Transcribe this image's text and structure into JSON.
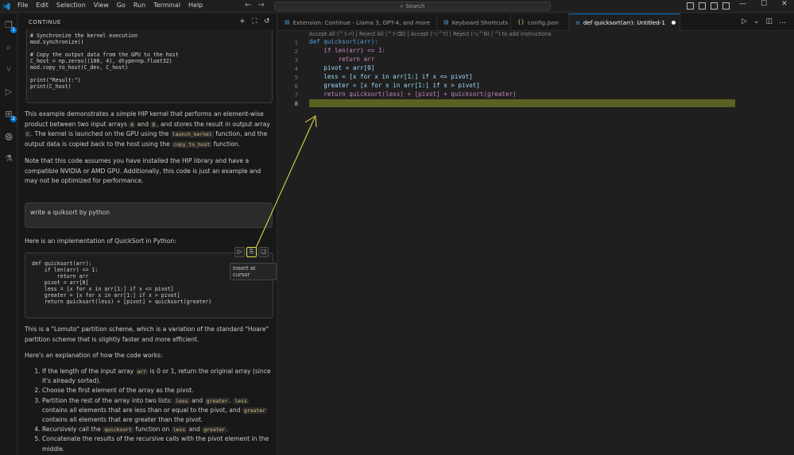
{
  "titlebar": {
    "menus": [
      "File",
      "Edit",
      "Selection",
      "View",
      "Go",
      "Run",
      "Terminal",
      "Help"
    ],
    "search_placeholder": "Search"
  },
  "activity": {
    "explorer_badge": "1",
    "extensions_badge": "2"
  },
  "sidebar": {
    "title": "CONTINUE",
    "prev_code": "# Synchronize the kernel execution\nmod.synchronize()\n\n# Copy the output data from the GPU to the host\nC_host = np.zeros((100, 4), dtype=np.float32)\nmod.copy_to_host(C_dev, C_host)\n\nprint(\"Result:\")\nprint(C_host)",
    "para1": {
      "t1": "This example demonstrates a simple HIP kernel that performs an element-wise product between two input arrays ",
      "c1": "A",
      "t2": " and ",
      "c2": "B",
      "t3": ", and stores the result in output array ",
      "c3": "C",
      "t4": ". The kernel is launched on the GPU using the ",
      "c4": "launch_kernel",
      "t5": " function, and the output data is copied back to the host using the ",
      "c5": "copy_to_host",
      "t6": " function."
    },
    "para2": "Note that this code assumes you have installed the HIP library and have a compatible NVIDIA or AMD GPU. Additionally, this code is just an example and may not be optimized for performance.",
    "user_prompt": "write a quiksort by python",
    "answer_intro": "Here is an implementation of QuickSort in Python:",
    "qs_code": "def quicksort(arr):\n    if len(arr) <= 1:\n        return arr\n    pivot = arr[0]\n    less = [x for x in arr[1:] if x <= pivot]\n    greater = [x for x in arr[1:] if x > pivot]\n    return quicksort(less) + [pivot] + quicksort(greater)",
    "tooltip": "Insert at cursor",
    "lomuto_text": "This is a \"Lomuto\" partition scheme, which is a variation of the standard \"Hoare\" partition scheme that is slightly faster and more efficient.",
    "explain_intro": "Here's an explanation of how the code works:",
    "steps": {
      "s1a": "If the length of the input array ",
      "s1c": "arr",
      "s1b": " is 0 or 1, return the original array (since it's already sorted).",
      "s2": "Choose the first element of the array as the pivot.",
      "s3a": "Partition the rest of the array into two lists: ",
      "s3c1": "less",
      "s3b": " and ",
      "s3c2": "greater",
      "s3d": ". ",
      "s3c3": "less",
      "s3e": " contains all elements that are less than or equal to the pivot, and ",
      "s3c4": "greater",
      "s3f": " contains all elements that are greater than the pivot.",
      "s4a": "Recursively call the ",
      "s4c1": "quicksort",
      "s4b": " function on ",
      "s4c2": "less",
      "s4d": " and ",
      "s4c3": "greater",
      "s4e": ".",
      "s5": "Concatenate the results of the recursive calls with the pivot element in the middle."
    }
  },
  "tabs": [
    {
      "label": "Extension: Continue - Llama 3, GPT-4, and more"
    },
    {
      "label": "Keyboard Shortcuts"
    },
    {
      "label": "config.json"
    },
    {
      "label": "def quicksort(arr): Untitled-1"
    }
  ],
  "editor": {
    "hint": "Accept All (^⇧⏎) | Reject All (^⇧⌫) | Accept (⌥^Y) | Reject (⌥^N) | ^I to add instructions",
    "line_numbers": [
      "1",
      "2",
      "3",
      "4",
      "5",
      "6",
      "7",
      "8"
    ],
    "lines": [
      "def quicksort(arr):",
      "    if len(arr) <= 1:",
      "        return arr",
      "    pivot = arr[0]",
      "    less = [x for x in arr[1:] if x <= pivot]",
      "    greater = [x for x in arr[1:] if x > pivot]",
      "    return quicksort(less) + [pivot] + quicksort(greater)",
      ""
    ]
  },
  "colors": {
    "accent": "#0078d4",
    "highlight_line": "#5b6023",
    "annotation": "#e8e04a"
  }
}
